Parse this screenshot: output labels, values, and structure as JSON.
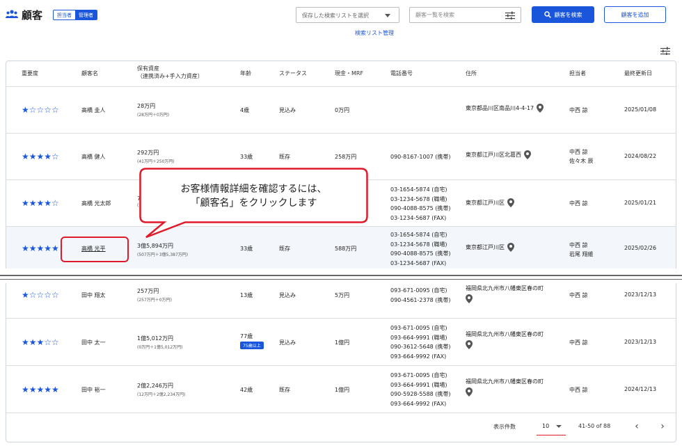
{
  "header": {
    "title": "顧客",
    "role_toggle": [
      "担当者",
      "管理者"
    ],
    "saved_search_placeholder": "保存した検索リストを選択",
    "search_placeholder": "顧客一覧を検索",
    "search_button": "顧客を検索",
    "add_button": "顧客を追加",
    "saved_list_link": "検索リスト管理"
  },
  "colors": {
    "accent": "#1a56db",
    "annotation": "#e0192b"
  },
  "table": {
    "columns": {
      "importance": "重要度",
      "name": "顧客名",
      "assets": "保有資産",
      "assets_sub": "（連携済み+手入力資産）",
      "age": "年齢",
      "status": "ステータス",
      "cash": "現金・MRF",
      "phone": "電話番号",
      "address": "住所",
      "owner": "担当者",
      "updated": "最終更新日"
    },
    "rows": [
      {
        "stars": "★☆☆☆☆",
        "name": "高橋 圭人",
        "assets": "28万円",
        "assets_sub": "(28万円＋0万円)",
        "age": "4歳",
        "status": "見込み",
        "cash": "0万円",
        "phones": [],
        "address": "東京都品川区南品川4-4-17",
        "owners": [
          "中西 諒"
        ],
        "updated": "2025/01/08"
      },
      {
        "stars": "★★★★☆",
        "name": "高橋 健人",
        "assets": "292万円",
        "assets_sub": "(41万円＋250万円)",
        "age": "33歳",
        "status": "既存",
        "cash": "258万円",
        "phones": [
          "090-8167-1007 (携帯)"
        ],
        "address": "東京都江戸川区北葛西",
        "owners": [
          "中西 諒",
          "佐々木 辰"
        ],
        "updated": "2024/08/22"
      },
      {
        "stars": "★★★★☆",
        "name": "高橋 光太郎",
        "assets": "7",
        "assets_sub": "(",
        "age": "",
        "status": "",
        "cash": "",
        "phones": [
          "03-1654-5874 (自宅)",
          "03-1234-5678 (職場)",
          "090-4088-8575 (携帯)",
          "03-1234-5687 (FAX)"
        ],
        "address": "東京都江戸川区",
        "owners": [
          "中西 諒"
        ],
        "updated": "2025/01/21"
      },
      {
        "stars": "★★★★★",
        "name": "高橋 光平",
        "assets": "3億5,894万円",
        "assets_sub": "(507万円＋3億5,387万円)",
        "age": "33歳",
        "status": "既存",
        "cash": "588万円",
        "phones": [
          "03-1654-5874 (自宅)",
          "03-1234-5678 (職場)",
          "090-4088-8575 (携帯)",
          "03-1234-5687 (FAX)"
        ],
        "address": "東京都江戸川区",
        "owners": [
          "中西 諒",
          "岩尾 翔維"
        ],
        "updated": "2025/02/26"
      },
      {
        "stars": "★☆☆☆☆",
        "name": "田中 翔太",
        "assets": "257万円",
        "assets_sub": "(257万円＋0万円)",
        "age": "13歳",
        "status": "見込み",
        "cash": "5万円",
        "phones": [
          "093-671-0095 (自宅)",
          "090-4561-2378 (携帯)"
        ],
        "address": "福岡県北九州市八幡東区春の町",
        "owners": [
          "中西 諒"
        ],
        "updated": "2023/12/13"
      },
      {
        "stars": "★★★☆☆",
        "name": "田中 太一",
        "assets": "1億5,012万円",
        "assets_sub": "(0万円＋1億5,012万円)",
        "age": "77歳",
        "age_badge": "75歳以上",
        "status": "見込み",
        "cash": "1億円",
        "phones": [
          "093-671-0095 (自宅)",
          "093-664-9991 (職場)",
          "090-3612-5648 (携帯)",
          "093-664-9992 (FAX)"
        ],
        "address": "福岡県北九州市八幡東区春の町",
        "owners": [
          "中西 諒"
        ],
        "updated": "2023/12/13"
      },
      {
        "stars": "★★★★★",
        "name": "田中 裕一",
        "assets": "2億2,246万円",
        "assets_sub": "(12万円＋2億2,234万円)",
        "age": "42歳",
        "status": "既存",
        "cash": "1億円",
        "phones": [
          "093-671-0095 (自宅)",
          "093-664-9991 (職場)",
          "090-5928-5588 (携帯)",
          "093-664-9992 (FAX)"
        ],
        "address": "福岡県北九州市八幡東区春の町",
        "owners": [
          "中西 諒"
        ],
        "updated": "2024/12/13"
      }
    ]
  },
  "callout": {
    "line1": "お客様情報詳細を確認するには、",
    "line2": "「顧客名」をクリックします"
  },
  "pagination": {
    "per_page_label": "表示件数",
    "per_page_value": "10",
    "range": "41-50 of 88",
    "prev": "‹",
    "next": "›"
  }
}
